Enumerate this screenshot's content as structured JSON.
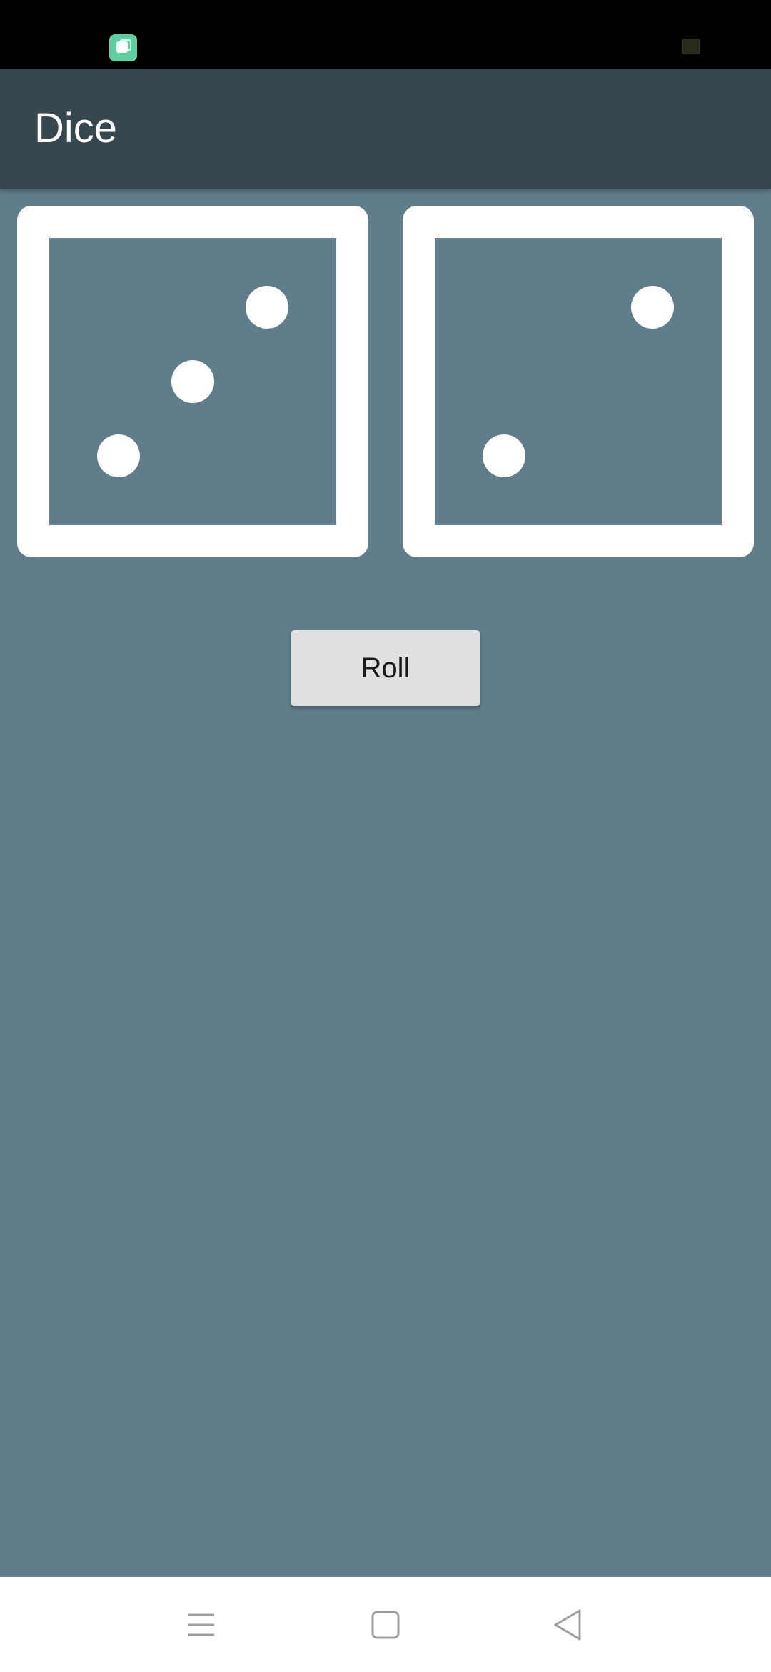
{
  "app_bar": {
    "title": "Dice"
  },
  "dice": [
    {
      "value": 3
    },
    {
      "value": 2
    }
  ],
  "roll_button": {
    "label": "Roll"
  },
  "navigation": {
    "icons": [
      "menu-icon",
      "home-icon",
      "back-icon"
    ]
  },
  "colors": {
    "status_bar": "#000000",
    "app_bar": "#37474f",
    "background": "#607d8b",
    "die_border": "#ffffff",
    "button": "#e0e0e0",
    "nav_bar": "#ffffff",
    "nav_icon": "#9e9e9e"
  }
}
